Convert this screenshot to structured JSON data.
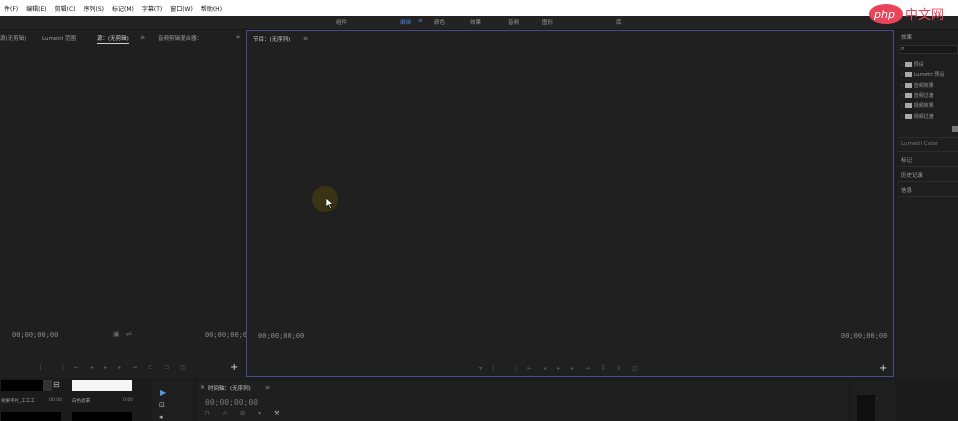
{
  "menu": [
    "件(F)",
    "编辑(E)",
    "剪辑(C)",
    "序列(S)",
    "标记(M)",
    "字幕(T)",
    "窗口(W)",
    "帮助(H)"
  ],
  "workspaces": [
    {
      "label": "组件",
      "active": false
    },
    {
      "label": "编辑",
      "active": true
    },
    {
      "label": "颜色",
      "active": false
    },
    {
      "label": "效果",
      "active": false
    },
    {
      "label": "音频",
      "active": false
    },
    {
      "label": "图形",
      "active": false
    },
    {
      "label": "库",
      "active": false
    }
  ],
  "logo": {
    "brand": "php",
    "suffix": "中文网",
    "color": "#e8455b"
  },
  "source_panel": {
    "tabs": [
      "源(无剪辑)",
      "Lumetri 范围",
      "源：(无剪辑)",
      "音频剪辑混合器："
    ],
    "active_tab": 2,
    "timecode_left": "00;00;00;00",
    "timecode_right": "00;00;00;00"
  },
  "program_panel": {
    "title": "节目：(无序列)",
    "timecode_left": "00;00;00;00",
    "timecode_right": "00;00;00;00"
  },
  "effects_panel": {
    "title": "效果",
    "items": [
      "预设",
      "Lumetri 预设",
      "音频效果",
      "音频过渡",
      "视频效果",
      "视频过渡"
    ],
    "lumetri_label": "Lumetri Color",
    "sections": [
      "标记",
      "历史记录",
      "信息"
    ]
  },
  "timeline_panel": {
    "title": "时间轴：(无序列)",
    "timecode": "00;00;00;00"
  },
  "project_panel": {
    "item1": "效果平片_工工工",
    "item1_meta": "00:00",
    "item2": "白色遮罩",
    "item2_meta": "0:00"
  },
  "colors": {
    "accent": "#4f7ddb",
    "cursor_glow": "#3a3414",
    "panel_border": "#4a4a8c"
  }
}
